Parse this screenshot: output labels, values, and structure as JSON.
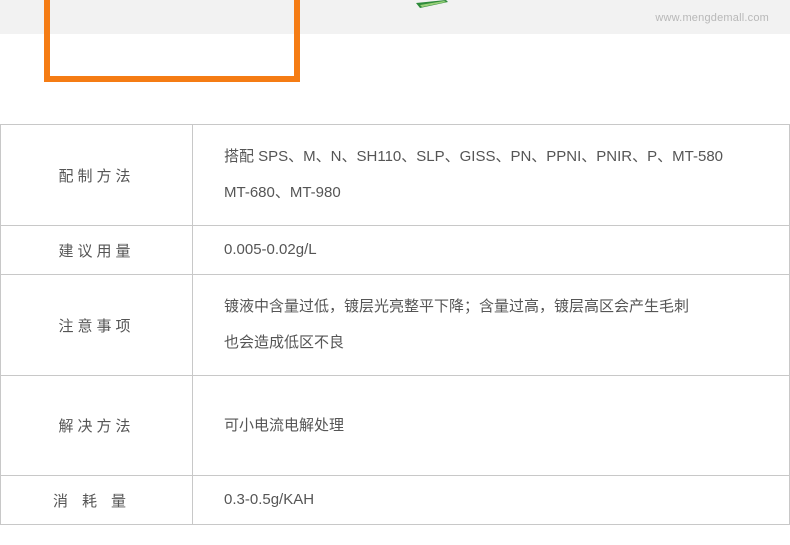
{
  "header": {
    "website": "www.mengdemall.com"
  },
  "colors": {
    "accent_orange": "#f57c14",
    "header_band": "#f2f2f2",
    "border": "#c8c8c8",
    "text": "#555555"
  },
  "table": {
    "rows": [
      {
        "label": "配制方法",
        "lines": [
          "搭配 SPS、M、N、SH110、SLP、GISS、PN、PPNI、PNIR、P、MT-580",
          "MT-680、MT-980"
        ]
      },
      {
        "label": "建议用量",
        "lines": [
          "0.005-0.02g/L"
        ]
      },
      {
        "label": "注意事项",
        "lines": [
          "镀液中含量过低，镀层光亮整平下降；含量过高，镀层高区会产生毛刺",
          "也会造成低区不良"
        ]
      },
      {
        "label": "解决方法",
        "lines": [
          "可小电流电解处理"
        ]
      },
      {
        "label": "消耗量",
        "lines": [
          "0.3-0.5g/KAH"
        ]
      }
    ]
  }
}
